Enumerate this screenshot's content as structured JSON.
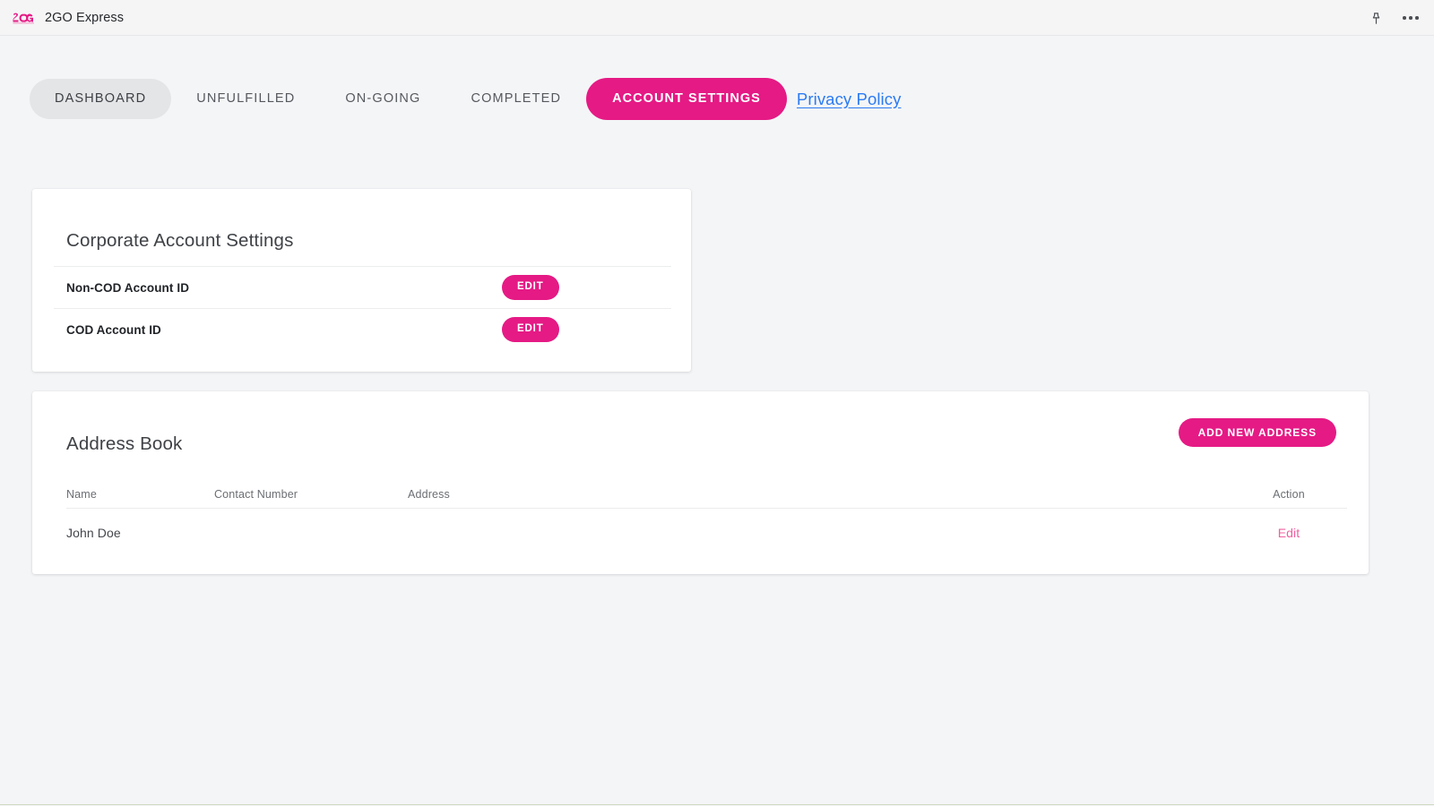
{
  "app_bar": {
    "logo_text": "2GO",
    "title": "2GO Express",
    "pin_icon": "pin-icon",
    "more_icon": "more-options-icon"
  },
  "nav": {
    "tabs": [
      {
        "label": "DASHBOARD",
        "state": "current"
      },
      {
        "label": "UNFULFILLED",
        "state": "normal"
      },
      {
        "label": "ON-GOING",
        "state": "normal"
      },
      {
        "label": "COMPLETED",
        "state": "normal"
      },
      {
        "label": "ACCOUNT SETTINGS",
        "state": "active"
      }
    ],
    "privacy_link": "Privacy Policy"
  },
  "corporate_card": {
    "title": "Corporate Account Settings",
    "rows": [
      {
        "label": "Non-COD Account ID",
        "action_label": "EDIT"
      },
      {
        "label": "COD Account ID",
        "action_label": "EDIT"
      }
    ]
  },
  "address_book": {
    "title": "Address Book",
    "add_button_label": "ADD NEW ADDRESS",
    "columns": [
      "Name",
      "Contact Number",
      "Address",
      "Action"
    ],
    "rows": [
      {
        "name": "John Doe",
        "contact": "",
        "address": "",
        "action_label": "Edit"
      }
    ]
  },
  "colors": {
    "brand_pink": "#e51a85",
    "link_blue": "#2b7bf3",
    "edit_link_pink": "#f0609f",
    "page_bg": "#f4f5f7",
    "card_bg": "#ffffff",
    "tab_current_bg": "#e4e5e6"
  }
}
